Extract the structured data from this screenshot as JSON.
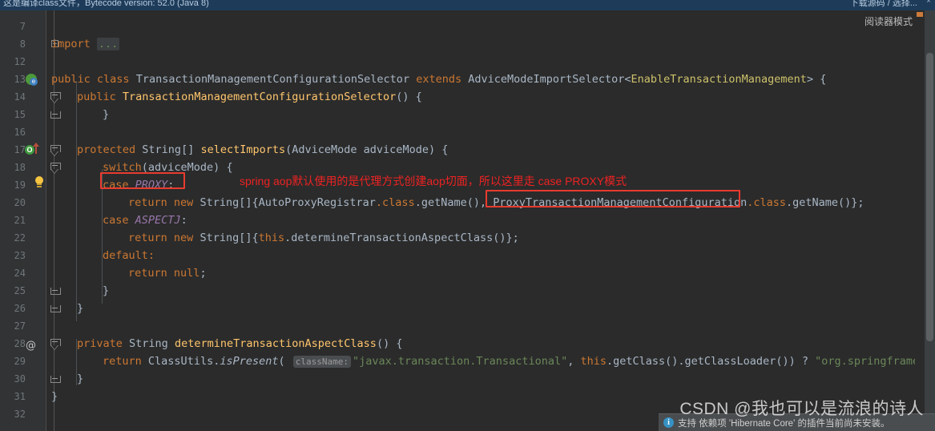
{
  "banner": {
    "text": "这是编译class文件，Bytecode version: 52.0 (Java 8)",
    "right_action": "下载源码 / 选择...",
    "close_label": "×"
  },
  "reader_mode": {
    "label": "阅读器模式"
  },
  "notification": {
    "icon": "info-icon",
    "text": "支持 依赖项 'Hibernate Core' 的插件当前尚未安装。"
  },
  "watermark": {
    "text": "CSDN @我也可以是流浪的诗人"
  },
  "annotation": {
    "text": "spring aop默认使用的是代理方式创建aop切面，所以这里走 case PROXY模式",
    "color": "#ee2222"
  },
  "highlight_color": "#e83b2f",
  "editor": {
    "file_language": "java",
    "lines": [
      {
        "num": "7",
        "gutter_icon": "",
        "fold": "",
        "code": ""
      },
      {
        "num": "8",
        "gutter_icon": "",
        "fold": "plus",
        "code": "import-folded"
      },
      {
        "num": "12",
        "gutter_icon": "",
        "fold": "",
        "code": ""
      },
      {
        "num": "13",
        "gutter_icon": "spring-bean-icon",
        "fold": "",
        "code": "class-decl"
      },
      {
        "num": "14",
        "gutter_icon": "",
        "fold": "minus-top",
        "code": "ctor"
      },
      {
        "num": "15",
        "gutter_icon": "",
        "fold": "end",
        "code": "close-brace-2"
      },
      {
        "num": "16",
        "gutter_icon": "",
        "fold": "",
        "code": ""
      },
      {
        "num": "17",
        "gutter_icon": "override-icon",
        "fold": "minus-top",
        "code": "select-imports"
      },
      {
        "num": "18",
        "gutter_icon": "",
        "fold": "minus-top",
        "code": "switch"
      },
      {
        "num": "19",
        "gutter_icon": "lightbulb-icon",
        "fold": "",
        "code": "case-proxy"
      },
      {
        "num": "20",
        "gutter_icon": "",
        "fold": "",
        "code": "return-proxy"
      },
      {
        "num": "21",
        "gutter_icon": "",
        "fold": "",
        "code": "case-aspectj"
      },
      {
        "num": "22",
        "gutter_icon": "",
        "fold": "",
        "code": "return-aspectj"
      },
      {
        "num": "23",
        "gutter_icon": "",
        "fold": "",
        "code": "default"
      },
      {
        "num": "24",
        "gutter_icon": "",
        "fold": "",
        "code": "return-null"
      },
      {
        "num": "25",
        "gutter_icon": "",
        "fold": "end",
        "code": "close-brace-2"
      },
      {
        "num": "26",
        "gutter_icon": "",
        "fold": "end",
        "code": "close-brace-1"
      },
      {
        "num": "27",
        "gutter_icon": "",
        "fold": "",
        "code": ""
      },
      {
        "num": "28",
        "gutter_icon": "at-icon",
        "fold": "minus-top",
        "code": "determine-decl"
      },
      {
        "num": "29",
        "gutter_icon": "",
        "fold": "",
        "code": "return-classutils"
      },
      {
        "num": "30",
        "gutter_icon": "",
        "fold": "end",
        "code": "close-brace-1"
      },
      {
        "num": "31",
        "gutter_icon": "",
        "fold": "",
        "code": "close-brace-0"
      },
      {
        "num": "32",
        "gutter_icon": "",
        "fold": "",
        "code": ""
      }
    ],
    "code_text": {
      "l8_import": "import",
      "l8_dots": "...",
      "l13": "public class TransactionManagementConfigurationSelector extends AdviceModeImportSelector<EnableTransactionManagement> {",
      "l13_kw1": "public",
      "l13_kw2": "class",
      "l13_name": "TransactionManagementConfigurationSelector",
      "l13_kw3": "extends",
      "l13_super": "AdviceModeImportSelector",
      "l13_generic": "EnableTransactionManagement",
      "l14_kw": "public",
      "l14_name": "TransactionManagementConfigurationSelector",
      "l14_tail": "() {",
      "l15": "}",
      "l17_kw": "protected",
      "l17_type": "String[]",
      "l17_name": "selectImports",
      "l17_params": "(AdviceMode adviceMode) {",
      "l18": "switch(adviceMode) {",
      "l18_kw": "switch",
      "l18_rest": "(adviceMode) {",
      "l19_kw": "case",
      "l19_const": "PROXY",
      "l19_colon": ":",
      "l20_kw1": "return",
      "l20_kw2": "new",
      "l20_type": "String[]{",
      "l20_cls1": "AutoProxyRegistrar",
      "l20_dot_class1": ".class",
      "l20_getname1": ".getName(), ",
      "l20_cls2": "ProxyTransactionManagementConfiguration",
      "l20_dot_class2": ".class",
      "l20_getname2": ".getName()};",
      "l21_kw": "case",
      "l21_const": "ASPECTJ",
      "l21_colon": ":",
      "l22_kw1": "return",
      "l22_kw2": "new",
      "l22_type": "String[]{",
      "l22_this": "this",
      "l22_rest": ".determineTransactionAspectClass()};",
      "l23": "default:",
      "l24_kw1": "return",
      "l24_kw2": "null",
      "l24_semi": ";",
      "l25": "}",
      "l26": "}",
      "l28_kw": "private",
      "l28_type": "String",
      "l28_name": "determineTransactionAspectClass",
      "l28_tail": "() {",
      "l29_kw": "return",
      "l29_cls": "ClassUtils",
      "l29_dot": ".",
      "l29_method": "isPresent",
      "l29_paren": "( ",
      "l29_hint": "className:",
      "l29_str1": "\"javax.transaction.Transactional\"",
      "l29_comma": ", ",
      "l29_this": "this",
      "l29_mid": ".getClass().getClassLoader()) ? ",
      "l29_str2": "\"org.springframework",
      "l30": "}",
      "l31": "}"
    }
  }
}
